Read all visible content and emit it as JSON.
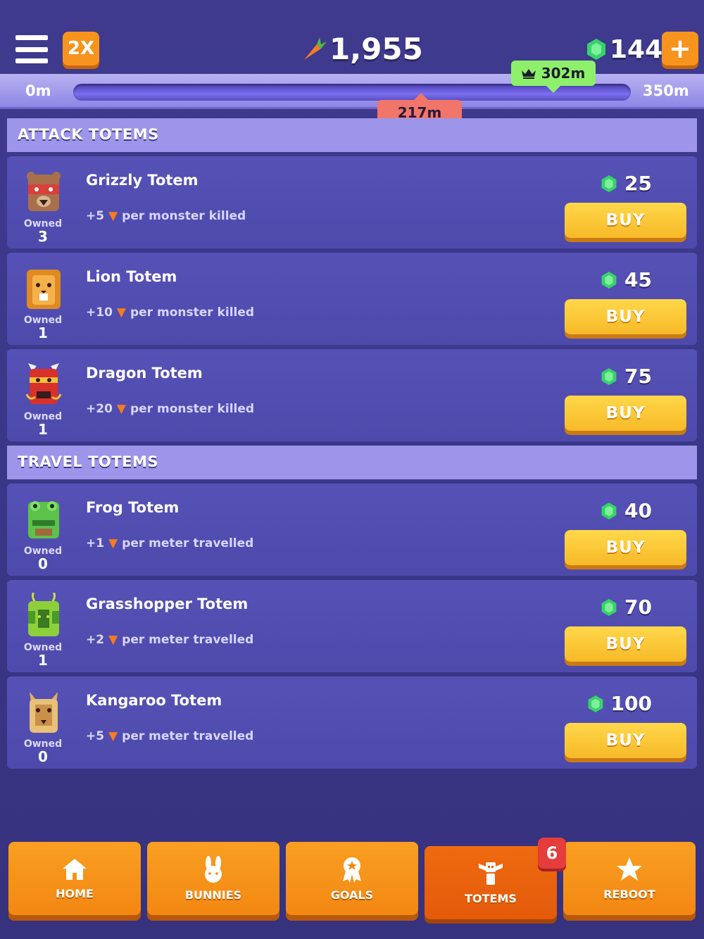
{
  "header": {
    "multiplier_label": "2X",
    "carrots": "1,955",
    "gems": "144"
  },
  "progress": {
    "start_label": "0m",
    "end_label": "350m",
    "current_label": "217m",
    "best_label": "302m"
  },
  "sections": {
    "attack_title": "ATTACK TOTEMS",
    "travel_title": "TRAVEL TOTEMS"
  },
  "owned_label": "Owned",
  "buy_label": "BUY",
  "attack_totems": [
    {
      "name": "Grizzly Totem",
      "bonus": "+5",
      "desc": "per monster killed",
      "price": "25",
      "owned": "3"
    },
    {
      "name": "Lion Totem",
      "bonus": "+10",
      "desc": "per monster killed",
      "price": "45",
      "owned": "1"
    },
    {
      "name": "Dragon Totem",
      "bonus": "+20",
      "desc": "per monster killed",
      "price": "75",
      "owned": "1"
    }
  ],
  "travel_totems": [
    {
      "name": "Frog Totem",
      "bonus": "+1",
      "desc": "per meter travelled",
      "price": "40",
      "owned": "0"
    },
    {
      "name": "Grasshopper Totem",
      "bonus": "+2",
      "desc": "per meter travelled",
      "price": "70",
      "owned": "1"
    },
    {
      "name": "Kangaroo Totem",
      "bonus": "+5",
      "desc": "per meter travelled",
      "price": "100",
      "owned": "0"
    }
  ],
  "tabs": {
    "home": "HOME",
    "bunnies": "BUNNIES",
    "goals": "GOALS",
    "totems": "TOTEMS",
    "reboot": "REBOOT",
    "totems_badge": "6"
  },
  "colors": {
    "background": "#3b3788",
    "accent_orange": "#f7941d",
    "buy_yellow": "#ffd84a",
    "gem_green": "#35d36a",
    "section_header": "#9d95ea"
  },
  "icons": [
    "menu-icon",
    "carrot-icon",
    "gem-icon",
    "plus-icon",
    "crown-icon",
    "home-icon",
    "bunny-icon",
    "medal-icon",
    "totem-icon",
    "star-icon"
  ]
}
